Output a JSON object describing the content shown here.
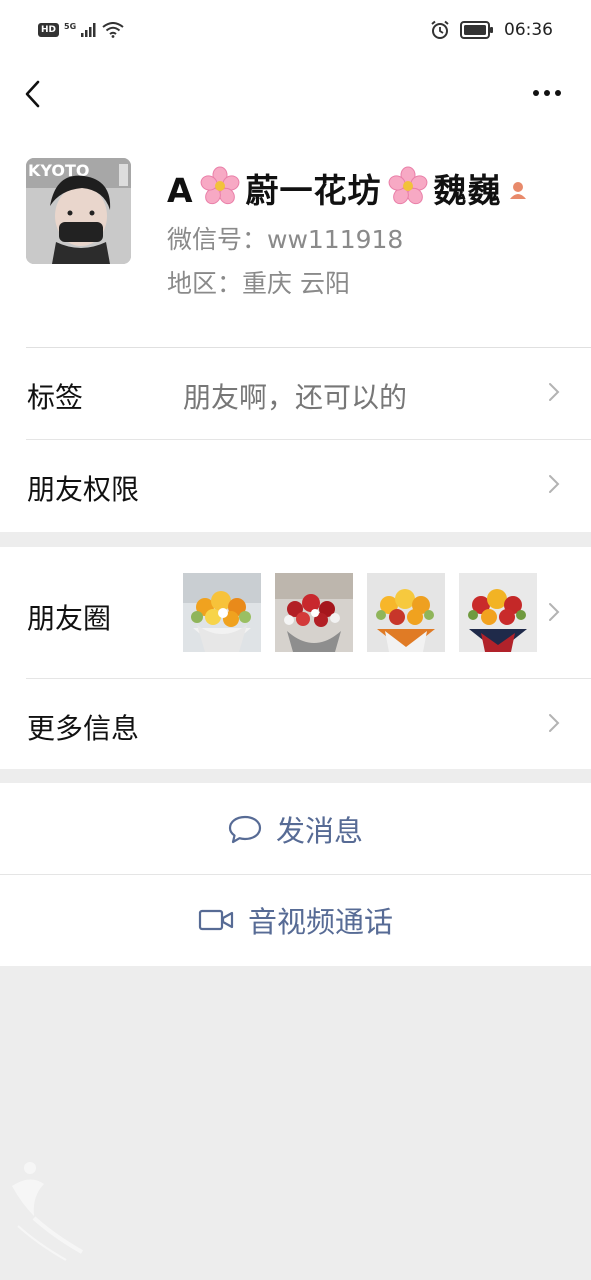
{
  "status_bar": {
    "left_badges": [
      "HD",
      "5G"
    ],
    "left_icons": [
      "signal-icon",
      "wifi-icon"
    ],
    "right_icons": [
      "alarm-icon",
      "battery-icon"
    ],
    "time": "06:36"
  },
  "nav": {
    "back_icon": "chevron-left-icon",
    "more_icon": "more-dots-icon"
  },
  "profile": {
    "name_parts": [
      "A",
      "蔚一花坊",
      "魏巍"
    ],
    "name_emoji": "flower-emoji",
    "gender_icon": "female-user-icon",
    "wechat_id": "微信号：ww111918",
    "region": "地区：重庆  云阳"
  },
  "rows": {
    "tags": {
      "label": "标签",
      "value": "朋友啊，还可以的"
    },
    "permissions": {
      "label": "朋友权限"
    },
    "moments": {
      "label": "朋友圈",
      "thumbnail_count": 4
    },
    "more_info": {
      "label": "更多信息"
    }
  },
  "actions": {
    "message": {
      "label": "发消息",
      "icon": "chat-bubble-icon"
    },
    "video_call": {
      "label": "音视频通话",
      "icon": "video-camera-icon"
    }
  },
  "colors": {
    "link": "#576b95",
    "background": "#ededed",
    "secondary_text": "#8a8a8a"
  }
}
